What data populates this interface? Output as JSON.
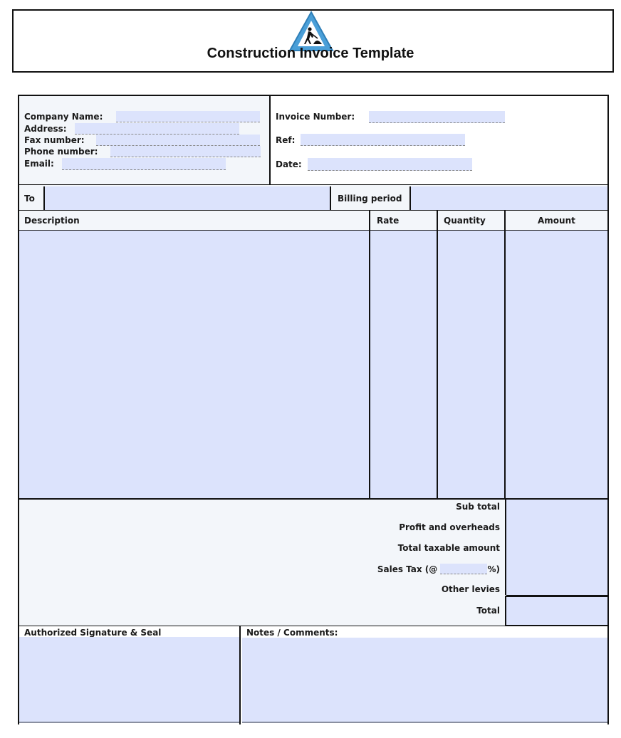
{
  "header": {
    "title": "Construction Invoice Template",
    "logo_icon": "construction-worker-warning-sign-icon"
  },
  "company": {
    "company_name_label": "Company Name:",
    "address_label": "Address:",
    "fax_label": "Fax number:",
    "phone_label": "Phone number:",
    "email_label": "Email:",
    "company_name_value": "",
    "address_value": "",
    "fax_value": "",
    "phone_value": "",
    "email_value": ""
  },
  "invoice": {
    "invoice_number_label": "Invoice Number:",
    "ref_label": "Ref:",
    "date_label": "Date:",
    "invoice_number_value": "",
    "ref_value": "",
    "date_value": ""
  },
  "billing": {
    "to_label": "To",
    "to_value": "",
    "billing_period_label": "Billing period",
    "billing_period_value": ""
  },
  "items_table": {
    "columns": [
      "Description",
      "Rate",
      "Quantity",
      "Amount"
    ],
    "rows": []
  },
  "totals": {
    "subtotal_label": "Sub total",
    "profit_label": "Profit and overheads",
    "taxable_label": "Total taxable amount",
    "sales_tax_prefix": "Sales Tax (@",
    "sales_tax_suffix": "%)",
    "sales_tax_rate": "",
    "other_levies_label": "Other levies",
    "total_label": "Total"
  },
  "footer": {
    "signature_label": "Authorized Signature & Seal",
    "notes_label": "Notes / Comments:",
    "notes_value": ""
  },
  "colors": {
    "field_fill": "#dce3fc",
    "panel_gray": "#f3f6fa",
    "border": "#111111",
    "logo_blue": "#4a9fd8"
  }
}
